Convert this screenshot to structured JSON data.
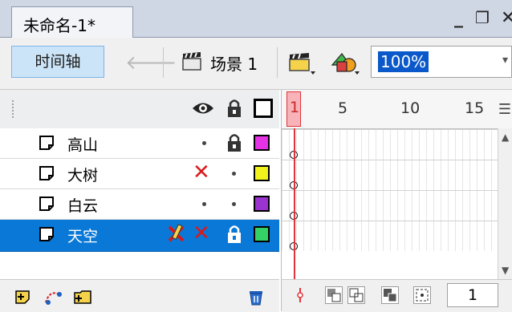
{
  "document": {
    "tab_title": "未命名-1*"
  },
  "window_controls": {
    "minimize": "_",
    "restore": "❐",
    "close": "✕"
  },
  "toolbar": {
    "timeline_label": "时间轴",
    "back_icon": "left-arrow-icon",
    "scene_label": "场景 1",
    "zoom_value": "100%"
  },
  "layer_header": {
    "icons": [
      "eye-icon",
      "lock-icon",
      "outline-icon"
    ]
  },
  "layers": [
    {
      "name": "高山",
      "visible_x": false,
      "hidden_pen": false,
      "locked": true,
      "color": "#e633e6",
      "selected": false
    },
    {
      "name": "大树",
      "visible_x": true,
      "hidden_pen": false,
      "locked": false,
      "color": "#f2f21c",
      "selected": false
    },
    {
      "name": "白云",
      "visible_x": false,
      "hidden_pen": false,
      "locked": false,
      "color": "#9b33d0",
      "selected": false
    },
    {
      "name": "天空",
      "visible_x": true,
      "hidden_pen": true,
      "locked": true,
      "color": "#33d166",
      "selected": true
    }
  ],
  "ruler": {
    "playhead": "1",
    "ticks": [
      "5",
      "10",
      "15"
    ]
  },
  "frame_footer": {
    "current_frame": "1"
  },
  "colors": {
    "selected_row": "#0a78d7",
    "playhead": "#e0353c",
    "zoom_highlight": "#0a58c9"
  }
}
